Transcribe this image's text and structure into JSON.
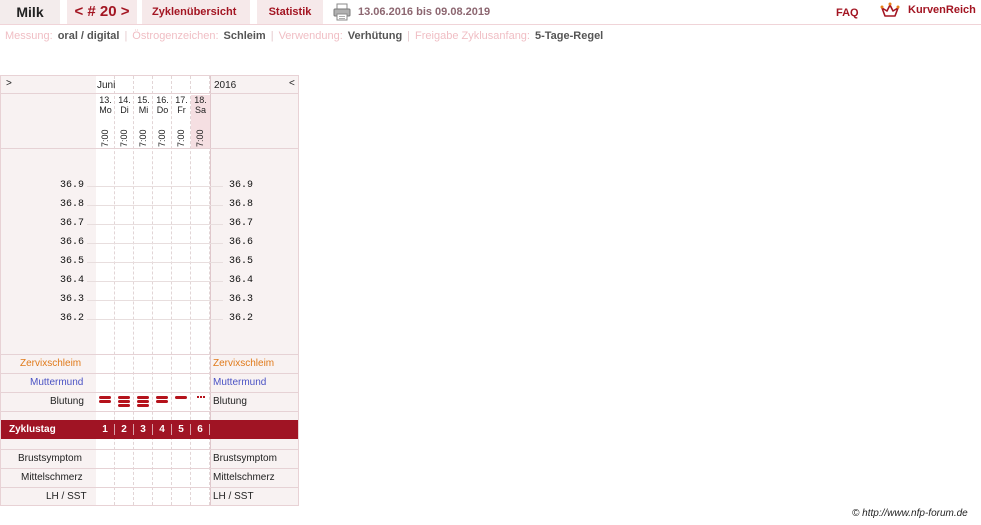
{
  "topbar": {
    "user": "Milk",
    "cycle": "< # 20 >",
    "overview_tab": "Zyklenübersicht",
    "stats_tab": "Statistik",
    "date_range": "13.06.2016 bis 09.08.2019",
    "faq": "FAQ",
    "brand": "KurvenReich",
    "accent_color": "#a31522"
  },
  "settings": [
    {
      "label": "Messung:",
      "value": "oral / digital"
    },
    {
      "label": "Östrogenzeichen:",
      "value": "Schleim"
    },
    {
      "label": "Verwendung:",
      "value": "Verhütung"
    },
    {
      "label": "Freigabe Zyklusanfang:",
      "value": "5-Tage-Regel"
    }
  ],
  "chart": {
    "nav_left": ">",
    "nav_right": "<",
    "month": "Juni",
    "year": "2016",
    "days": [
      {
        "date": "13.",
        "weekday": "Mo",
        "time": "7:00",
        "weekend": false
      },
      {
        "date": "14.",
        "weekday": "Di",
        "time": "7:00",
        "weekend": false
      },
      {
        "date": "15.",
        "weekday": "Mi",
        "time": "7:00",
        "weekend": false
      },
      {
        "date": "16.",
        "weekday": "Do",
        "time": "7:00",
        "weekend": false
      },
      {
        "date": "17.",
        "weekday": "Fr",
        "time": "7:00",
        "weekend": false
      },
      {
        "date": "18.",
        "weekday": "Sa",
        "time": "7:00",
        "weekend": true
      }
    ],
    "temperatures": [
      "36.9",
      "36.8",
      "36.7",
      "36.6",
      "36.5",
      "36.4",
      "36.3",
      "36.2"
    ],
    "rows": {
      "cervix_mucus": "Zervixschleim",
      "cervix": "Muttermund",
      "bleeding": "Blutung",
      "cycle_day": "Zyklustag",
      "breast": "Brustsymptom",
      "midpain": "Mittelschmerz",
      "lh": "LH / SST"
    },
    "cycle_days": [
      "1",
      "2",
      "3",
      "4",
      "5",
      "6"
    ],
    "bleeding_levels": [
      2,
      3,
      3,
      2,
      1,
      0.5
    ],
    "bleed_color": "#b5121b"
  },
  "footer": {
    "copyright": "© http://www.nfp-forum.de"
  }
}
